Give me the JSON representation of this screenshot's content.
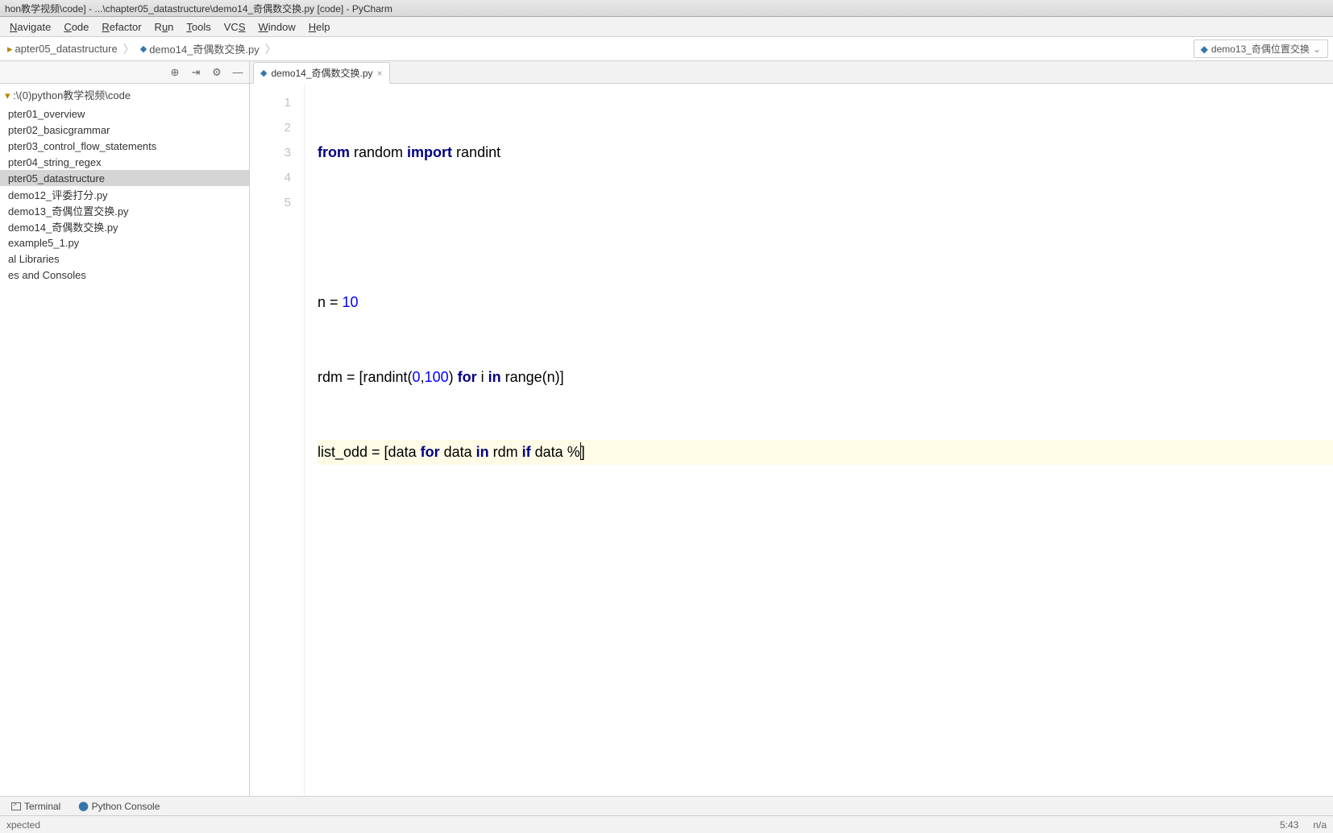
{
  "title": "hon教学视频\\code] - ...\\chapter05_datastructure\\demo14_奇偶数交换.py [code] - PyCharm",
  "menu": {
    "navigate": "Navigate",
    "code": "Code",
    "refactor": "Refactor",
    "run": "Run",
    "tools": "Tools",
    "vcs": "VCS",
    "window": "Window",
    "help": "Help"
  },
  "breadcrumb": {
    "item1": "apter05_datastructure",
    "item2": "demo14_奇偶数交换.py"
  },
  "run_config": "demo13_奇偶位置交换",
  "sidebar": {
    "root": ":\\(0)python教学视频\\code",
    "items": [
      "pter01_overview",
      "pter02_basicgrammar",
      "pter03_control_flow_statements",
      "pter04_string_regex",
      "pter05_datastructure",
      "demo12_评委打分.py",
      "demo13_奇偶位置交换.py",
      "demo14_奇偶数交换.py",
      "example5_1.py",
      "al Libraries",
      "es and Consoles"
    ]
  },
  "tab": "demo14_奇偶数交换.py",
  "gutter": [
    "1",
    "2",
    "3",
    "4",
    "5"
  ],
  "code": {
    "l1": {
      "t1": "from",
      "t2": " random ",
      "t3": "import",
      "t4": " randint"
    },
    "l2": "",
    "l3": {
      "t1": "n = ",
      "t2": "10"
    },
    "l4": {
      "t1": "rdm = [randint(",
      "t2": "0",
      "t3": ",",
      "t4": "100",
      "t5": ") ",
      "t6": "for",
      "t7": " i ",
      "t8": "in",
      "t9": " range(n)]"
    },
    "l5": {
      "t1": "list_odd = [data ",
      "t2": "for",
      "t3": " data ",
      "t4": "in",
      "t5": " rdm ",
      "t6": "if",
      "t7": " data %",
      "t8": "]"
    }
  },
  "bottom": {
    "terminal": "Terminal",
    "pyconsole": "Python Console"
  },
  "status": {
    "left": "xpected",
    "pos": "5:43",
    "enc": "n/a"
  }
}
